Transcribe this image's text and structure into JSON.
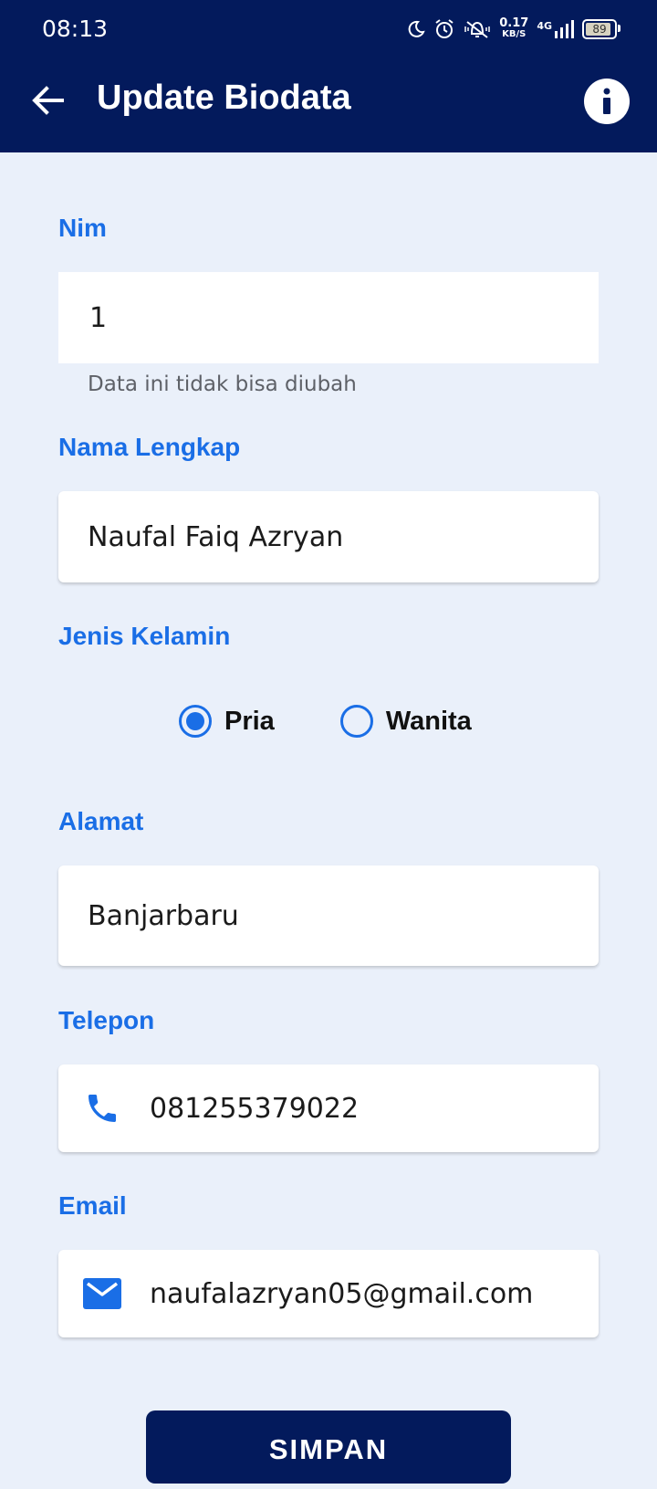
{
  "status_bar": {
    "time": "08:13",
    "speed_value": "0.17",
    "speed_unit": "KB/S",
    "network": "4G",
    "battery": "89",
    "icons": [
      "moon-icon",
      "alarm-icon",
      "vibrate-icon",
      "signal-icon",
      "battery-icon"
    ]
  },
  "app_bar": {
    "title": "Update Biodata",
    "back_icon": "arrow-left-icon",
    "info_icon": "info-icon"
  },
  "form": {
    "nim": {
      "label": "Nim",
      "value": "1",
      "helper": "Data ini tidak bisa diubah"
    },
    "nama": {
      "label": "Nama Lengkap",
      "value": "Naufal Faiq Azryan"
    },
    "jenis_kelamin": {
      "label": "Jenis Kelamin",
      "options": [
        "Pria",
        "Wanita"
      ],
      "selected": "Pria"
    },
    "alamat": {
      "label": "Alamat",
      "value": "Banjarbaru"
    },
    "telepon": {
      "label": "Telepon",
      "value": "081255379022",
      "icon": "phone-icon"
    },
    "email": {
      "label": "Email",
      "value": "naufalazryan05@gmail.com",
      "icon": "mail-icon"
    }
  },
  "save_button": {
    "label": "SIMPAN"
  },
  "colors": {
    "primary_dark": "#031a5c",
    "accent_blue": "#1a6ee6",
    "background": "#eaf0fa"
  }
}
